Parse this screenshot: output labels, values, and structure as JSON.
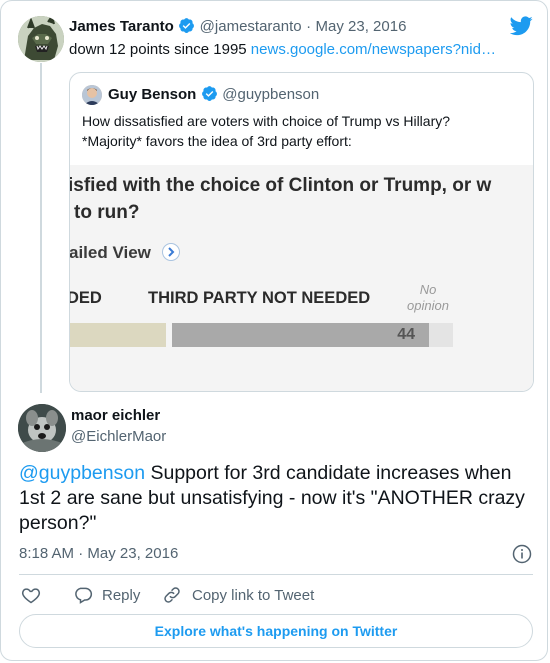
{
  "colors": {
    "accent": "#1d9bf0",
    "text": "#0f1419",
    "muted": "#536471",
    "border": "#cfd9de"
  },
  "tweet": {
    "author_name": "James Taranto",
    "author_handle": "@jamestaranto",
    "separator": "·",
    "date": "May 23, 2016",
    "text_plain": "down 12 points since 1995 ",
    "text_link": "news.google.com/newspapers?nid…",
    "avatar_icon": "godzilla-avatar-icon",
    "logo_icon": "twitter-bird-icon"
  },
  "quoted": {
    "author_name": "Guy Benson",
    "author_handle": "@guypbenson",
    "text_line1": "How dissatisfied are voters with choice of Trump vs Hillary?",
    "text_line2": "*Majority* favors the idea of 3rd party effort:",
    "image": {
      "question_line1": "isfied with the choice of Clinton or Trump, or w",
      "question_line2": "to run?",
      "detailed_view": "ailed View",
      "col_left": "DED",
      "col_mid": "THIRD PARTY NOT NEEDED",
      "col_right_1": "No",
      "col_right_2": "opinion",
      "bar_value": "44"
    }
  },
  "reply": {
    "author_name": "maor eichler",
    "author_handle": "@EichlerMaor",
    "mention": "@guypbenson",
    "text": " Support for 3rd candidate increases when 1st 2 are sane but unsatisfying  - now it's \"ANOTHER crazy person?\"",
    "time": "8:18 AM",
    "separator": "·",
    "date": "May 23, 2016"
  },
  "actions": {
    "reply_label": "Reply",
    "copy_label": "Copy link to Tweet",
    "explore_label": "Explore what's happening on Twitter"
  }
}
